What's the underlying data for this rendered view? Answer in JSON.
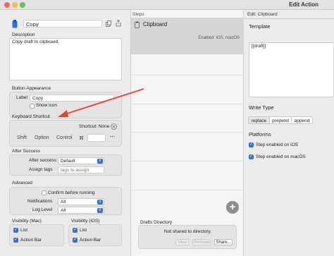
{
  "window": {
    "title": "Edit Action"
  },
  "action": {
    "name": "Copy",
    "description_label": "Description",
    "description": "Copy draft to clipboard."
  },
  "appearance": {
    "header": "Button Appearance",
    "label_caption": "Label",
    "label_value": "Copy",
    "show_icon": "Show icon"
  },
  "shortcut": {
    "header": "Keyboard Shortcut",
    "value": "Shortcut: None",
    "keys": [
      "Shift",
      "Option",
      "Control",
      "⌘"
    ]
  },
  "after_success": {
    "header": "After Success",
    "after_label": "After success",
    "after_value": "Default",
    "tags_label": "Assign tags",
    "tags_placeholder": "tags to assign"
  },
  "advanced": {
    "header": "Advanced",
    "confirm": "Confirm before running",
    "notifications_label": "Notifications",
    "notifications_value": "All",
    "log_label": "Log Level",
    "log_value": "All"
  },
  "visibility": {
    "mac_header": "Visibility (Mac)",
    "ios_header": "Visibility (iOS)",
    "mac_items": [
      "List",
      "Action Bar"
    ],
    "ios_items": [
      "List",
      "Action Bar"
    ]
  },
  "steps": {
    "header": "Steps",
    "items": [
      {
        "title": "Clipboard",
        "subtitle": "Enabled: iOS, macOS"
      }
    ],
    "add_icon": "+"
  },
  "drafts_directory": {
    "header": "Drafts Directory",
    "status": "Not shared to directory.",
    "view": "View",
    "remove": "Remove",
    "share": "Share..."
  },
  "edit_panel": {
    "header": "Edit: Clipboard",
    "template_label": "Template",
    "template_value": "[[draft]]",
    "write_type_label": "Write Type",
    "write_type_options": [
      "replace",
      "prepend",
      "append"
    ],
    "write_type_selected": "replace",
    "platforms_label": "Platforms",
    "platform_ios": "Step enabled on iOS",
    "platform_mac": "Step enabled on macOS"
  },
  "colors": {
    "accent": "#2f6fe6",
    "arrow": "#e8412c"
  }
}
